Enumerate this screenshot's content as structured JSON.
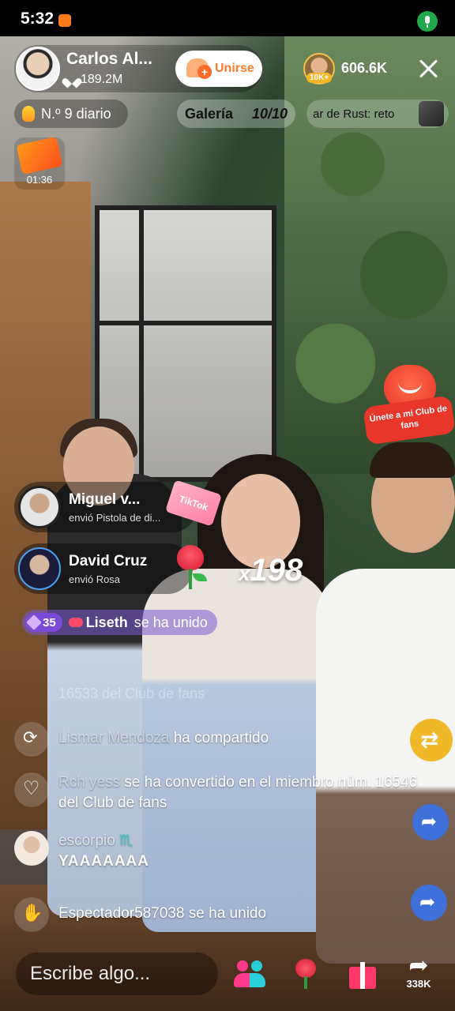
{
  "status_bar": {
    "time": "5:32"
  },
  "host": {
    "name": "Carlos Al...",
    "likes": "189.2M",
    "join_label": "Unirse"
  },
  "viewers": {
    "badge": "10K+",
    "count": "606.6K"
  },
  "pills": {
    "rank": "N.º 9 diario",
    "gallery_label": "Galería",
    "gallery_count": "10/10",
    "game_text": "ar de Rust: reto"
  },
  "timer": "01:36",
  "fan_club_badge": "Únete a mi Club de fans",
  "gifts": [
    {
      "user": "Miguel v...",
      "desc": "envió  Pistola de di..."
    },
    {
      "user": "David Cruz",
      "desc": "envió  Rosa"
    }
  ],
  "tiktok_sticker": "TikTok",
  "combo": {
    "prefix": "x",
    "value": "198"
  },
  "join_banner": {
    "level": "35",
    "user": "Liseth",
    "action": "se ha unido"
  },
  "faded_line": "16533 del Club de fans",
  "chat": [
    {
      "user": "Lismar Mendoza",
      "text": "ha compartido"
    },
    {
      "user": "Rch yess",
      "text": "se ha convertido en el miembro núm. 16546 del Club de fans"
    },
    {
      "user": "escorpio",
      "zodiac": "♏",
      "text": "YAAAAAAA"
    },
    {
      "user": "Espectador587038",
      "text": "se ha unido"
    }
  ],
  "bottom_bar": {
    "comment_placeholder": "Escribe algo...",
    "share_count": "338K"
  },
  "colors": {
    "join_orange": "#ff7a2a",
    "share_yellow": "#f0b92a",
    "forward_blue": "#3f6fd8",
    "level_purple": "#7a4bd8"
  }
}
